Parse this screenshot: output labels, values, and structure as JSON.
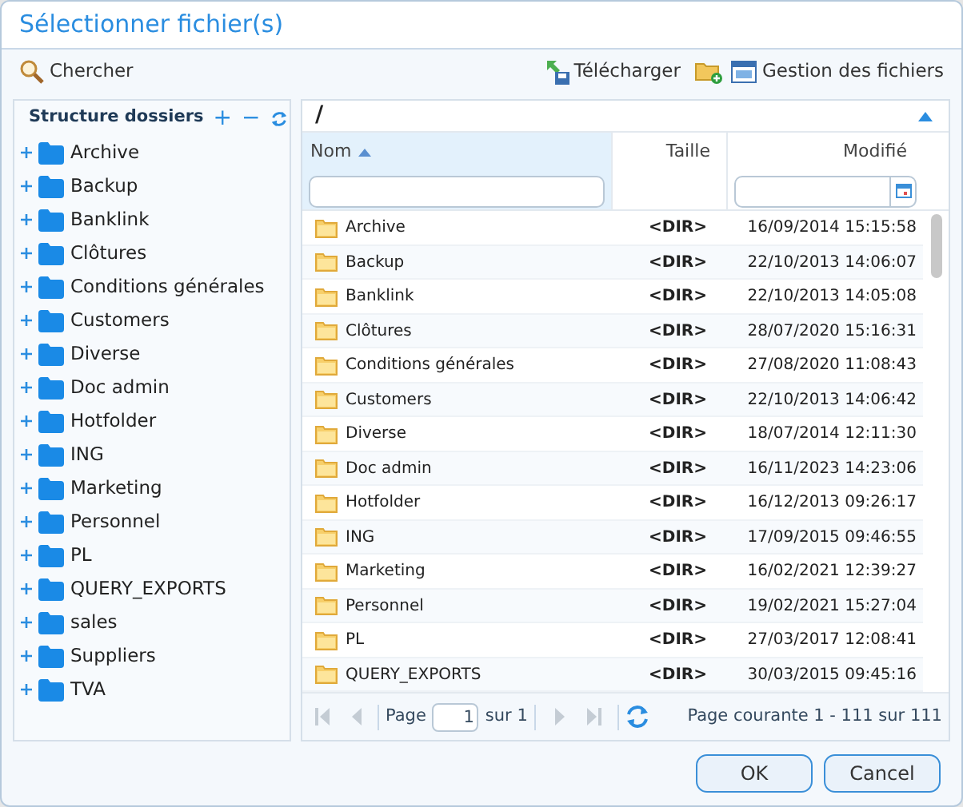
{
  "window": {
    "title": "Sélectionner fichier(s)"
  },
  "toolbar": {
    "search": "Chercher",
    "upload": "Télécharger",
    "manage": "Gestion des fichiers"
  },
  "tree": {
    "title": "Structure dossiers",
    "expand_all": "+",
    "collapse_all": "−",
    "items": [
      {
        "label": "Archive",
        "expanded": false
      },
      {
        "label": "Backup",
        "expanded": false
      },
      {
        "label": "Banklink",
        "expanded": false
      },
      {
        "label": "Clôtures",
        "expanded": false
      },
      {
        "label": "Conditions générales",
        "expanded": false
      },
      {
        "label": "Customers",
        "expanded": false
      },
      {
        "label": "Diverse",
        "expanded": false
      },
      {
        "label": "Doc admin",
        "expanded": false
      },
      {
        "label": "Hotfolder",
        "expanded": false
      },
      {
        "label": "ING",
        "expanded": false
      },
      {
        "label": "Marketing",
        "expanded": false
      },
      {
        "label": "Personnel",
        "expanded": false
      },
      {
        "label": "PL",
        "expanded": false
      },
      {
        "label": "QUERY_EXPORTS",
        "expanded": false
      },
      {
        "label": "sales",
        "expanded": false
      },
      {
        "label": "Suppliers",
        "expanded": false
      },
      {
        "label": "TVA",
        "expanded": false
      }
    ]
  },
  "grid": {
    "path": "/",
    "columns": [
      {
        "label": "Nom",
        "sorted": true
      },
      {
        "label": "Taille",
        "sorted": false
      },
      {
        "label": "Modifié",
        "sorted": false
      }
    ],
    "rows": [
      {
        "name": "Archive",
        "size": "<DIR>",
        "modified": "16/09/2014 15:15:58"
      },
      {
        "name": "Backup",
        "size": "<DIR>",
        "modified": "22/10/2013 14:06:07"
      },
      {
        "name": "Banklink",
        "size": "<DIR>",
        "modified": "22/10/2013 14:05:08"
      },
      {
        "name": "Clôtures",
        "size": "<DIR>",
        "modified": "28/07/2020 15:16:31"
      },
      {
        "name": "Conditions générales",
        "size": "<DIR>",
        "modified": "27/08/2020 11:08:43"
      },
      {
        "name": "Customers",
        "size": "<DIR>",
        "modified": "22/10/2013 14:06:42"
      },
      {
        "name": "Diverse",
        "size": "<DIR>",
        "modified": "18/07/2014 12:11:30"
      },
      {
        "name": "Doc admin",
        "size": "<DIR>",
        "modified": "16/11/2023 14:23:06"
      },
      {
        "name": "Hotfolder",
        "size": "<DIR>",
        "modified": "16/12/2013 09:26:17"
      },
      {
        "name": "ING",
        "size": "<DIR>",
        "modified": "17/09/2015 09:46:55"
      },
      {
        "name": "Marketing",
        "size": "<DIR>",
        "modified": "16/02/2021 12:39:27"
      },
      {
        "name": "Personnel",
        "size": "<DIR>",
        "modified": "19/02/2021 15:27:04"
      },
      {
        "name": "PL",
        "size": "<DIR>",
        "modified": "27/03/2017 12:08:41"
      },
      {
        "name": "QUERY_EXPORTS",
        "size": "<DIR>",
        "modified": "30/03/2015 09:45:16"
      }
    ]
  },
  "pager": {
    "page_label": "Page",
    "page": "1",
    "of": "sur 1",
    "status": "Page courante 1 - 111 sur 111"
  },
  "buttons": [
    "OK",
    "Cancel"
  ]
}
